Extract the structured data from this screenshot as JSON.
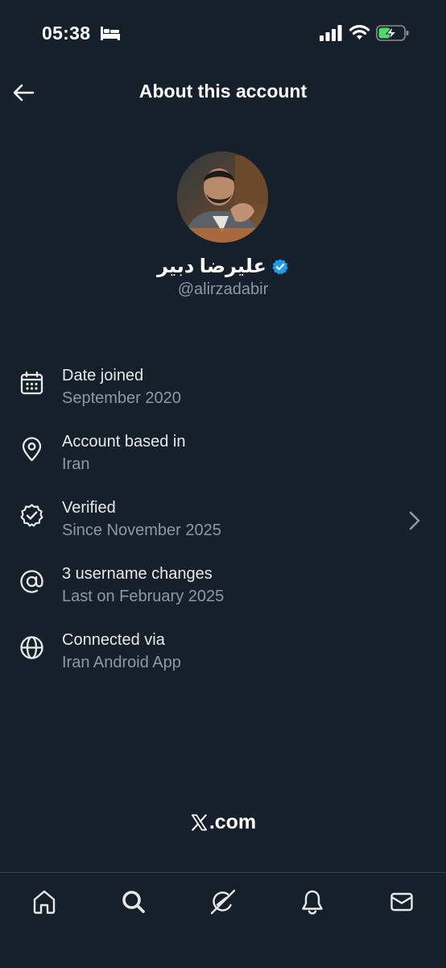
{
  "status_bar": {
    "time": "05:38",
    "icons": [
      "bed-icon",
      "signal-icon",
      "wifi-icon",
      "battery-charging-icon"
    ]
  },
  "header": {
    "title": "About this account",
    "back_icon": "arrow-left-icon"
  },
  "profile": {
    "name": "علیرضا دبیر",
    "handle": "@alirzadabir",
    "verified": true,
    "verified_color": "#1d9bf0"
  },
  "details": [
    {
      "icon": "calendar-icon",
      "title": "Date joined",
      "subtitle": "September 2020"
    },
    {
      "icon": "location-pin-icon",
      "title": "Account based in",
      "subtitle": "Iran"
    },
    {
      "icon": "verified-check-icon",
      "title": "Verified",
      "subtitle": "Since November 2025",
      "has_chevron": true
    },
    {
      "icon": "at-sign-icon",
      "title": "3 username changes",
      "subtitle": "Last on February 2025"
    },
    {
      "icon": "globe-icon",
      "title": "Connected via",
      "subtitle": "Iran Android App"
    }
  ],
  "footer": {
    "brand_suffix": ".com"
  },
  "tabs": [
    "home-icon",
    "search-icon",
    "grok-icon",
    "notifications-bell-icon",
    "messages-envelope-icon"
  ],
  "colors": {
    "background": "#15202b",
    "primary_text": "#e7e9ea",
    "secondary_text": "#8b98a5",
    "divider": "#38444d",
    "battery_charge": "#4cd964"
  }
}
